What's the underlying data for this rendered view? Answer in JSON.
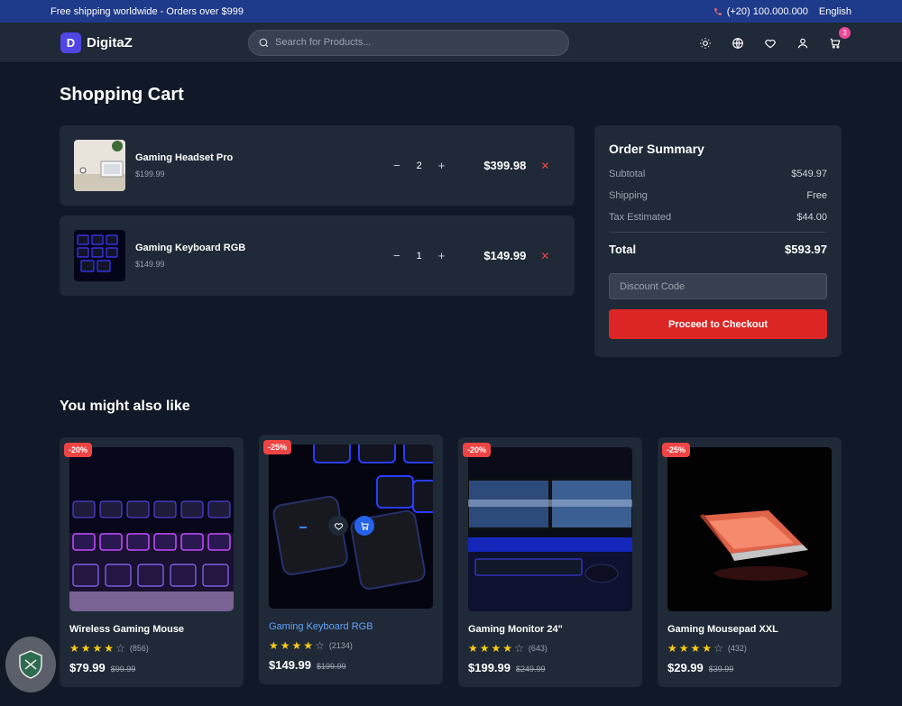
{
  "topbar": {
    "promo": "Free shipping worldwide - Orders over $999",
    "phone": "(+20) 100.000.000",
    "language": "English"
  },
  "nav": {
    "logo_letter": "D",
    "brand": "DigitaZ",
    "search_placeholder": "Search for Products...",
    "cart_count": "3"
  },
  "cart": {
    "title": "Shopping Cart",
    "items": [
      {
        "name": "Gaming Headset Pro",
        "price": "$199.99",
        "qty": "2",
        "total": "$399.98"
      },
      {
        "name": "Gaming Keyboard RGB",
        "price": "$149.99",
        "qty": "1",
        "total": "$149.99"
      }
    ]
  },
  "summary": {
    "title": "Order Summary",
    "subtotal_label": "Subtotal",
    "subtotal": "$549.97",
    "shipping_label": "Shipping",
    "shipping": "Free",
    "tax_label": "Tax Estimated",
    "tax": "$44.00",
    "total_label": "Total",
    "total": "$593.97",
    "discount_placeholder": "Discount Code",
    "checkout_label": "Proceed to Checkout"
  },
  "recommend": {
    "title": "You might also like",
    "products": [
      {
        "name": "Wireless Gaming Mouse",
        "discount": "-20%",
        "rating": 4,
        "reviews": "(856)",
        "price": "$79.99",
        "old_price": "$99.99"
      },
      {
        "name": "Gaming Keyboard RGB",
        "discount": "-25%",
        "rating": 4,
        "reviews": "(2134)",
        "price": "$149.99",
        "old_price": "$199.99"
      },
      {
        "name": "Gaming Monitor 24\"",
        "discount": "-20%",
        "rating": 4,
        "reviews": "(643)",
        "price": "$199.99",
        "old_price": "$249.99"
      },
      {
        "name": "Gaming Mousepad XXL",
        "discount": "-25%",
        "rating": 4,
        "reviews": "(432)",
        "price": "$29.99",
        "old_price": "$39.99"
      }
    ]
  },
  "colors": {
    "accent": "#dc2626",
    "brand": "#4f46e5",
    "topbar": "#1e3a8a",
    "highlight": "#60a5fa"
  }
}
